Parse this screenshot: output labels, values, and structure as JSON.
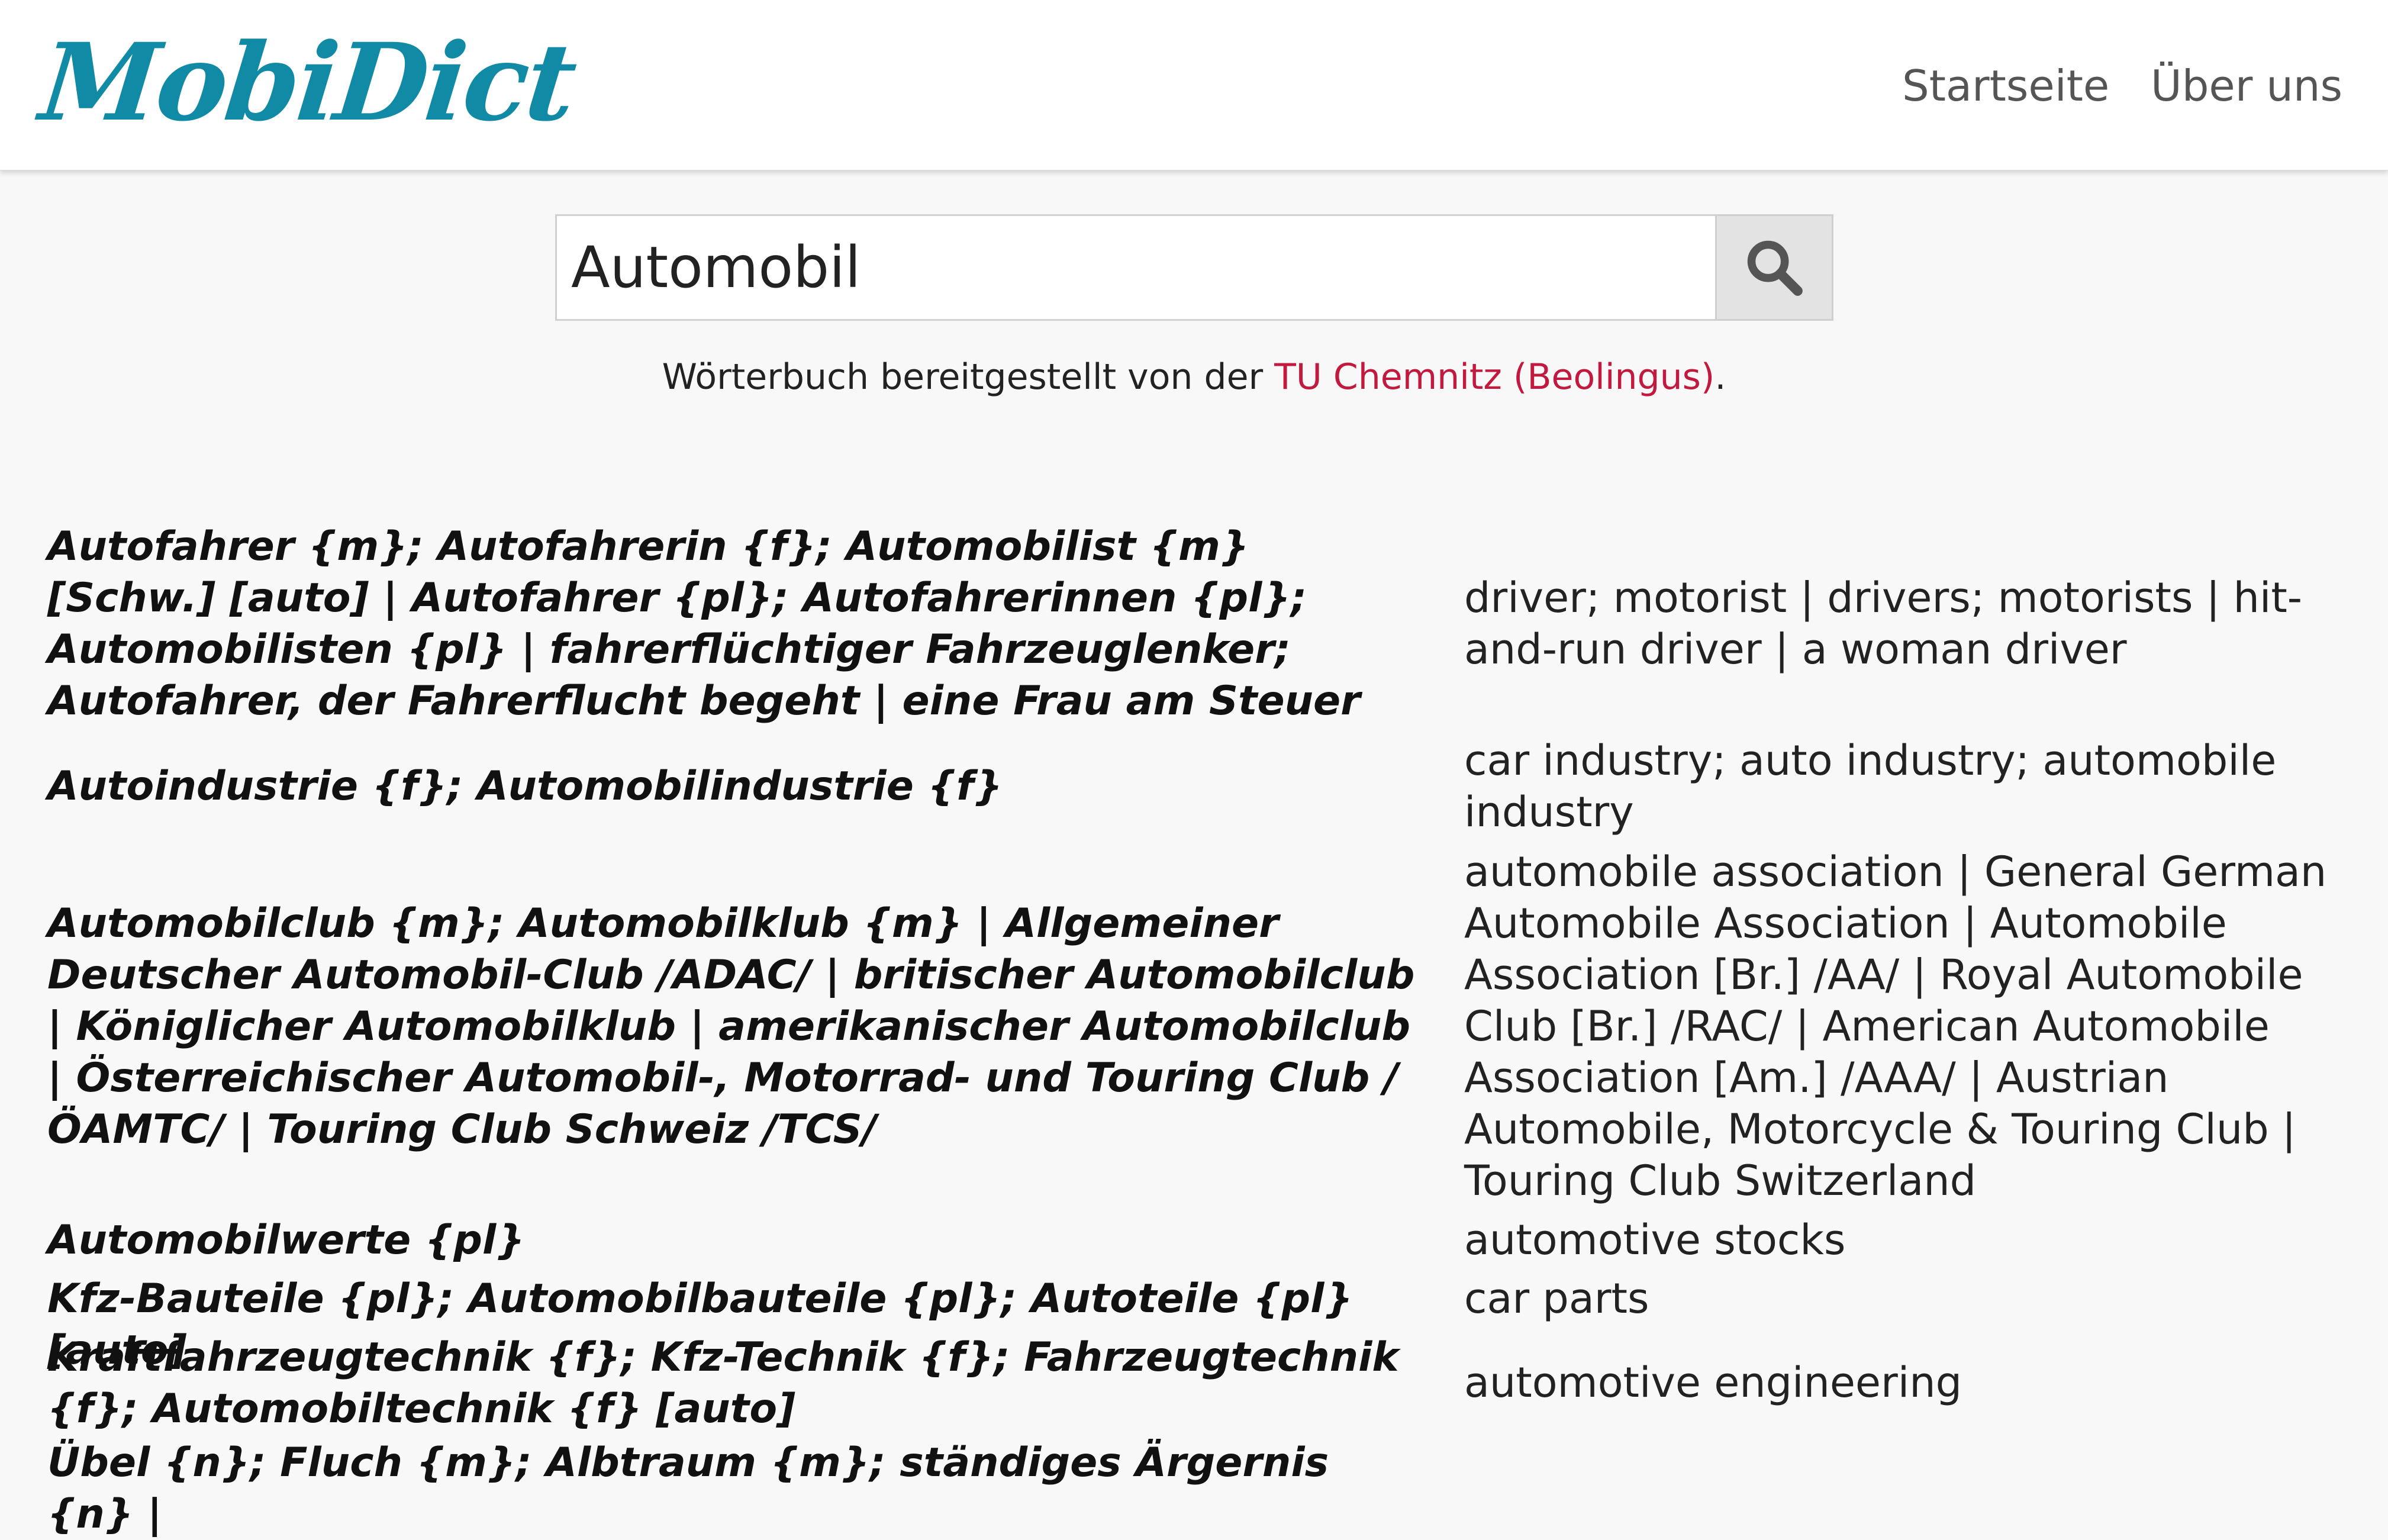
{
  "header": {
    "logo": "MobiDict",
    "nav": {
      "home": "Startseite",
      "about": "Über uns"
    }
  },
  "search": {
    "value": "Automobil",
    "button_icon": "search-icon"
  },
  "credit": {
    "prefix": "Wörterbuch bereitgestellt von der ",
    "link": "TU Chemnitz (Beolingus)",
    "suffix": "."
  },
  "results": [
    {
      "de": "Autofahrer {m}; Autofahrerin {f}; Automobilist {m} [Schw.] [auto] | Autofahrer {pl}; Autofahrerinnen {pl}; Automobilisten {pl} | fahrerflüchtiger Fahrzeuglenker; Autofahrer, der Fahrerflucht begeht | eine Frau am Steuer",
      "en": "driver; motorist | drivers; motorists | hit-and-run driver | a woman driver"
    },
    {
      "de": "Autoindustrie {f}; Automobilindustrie {f}",
      "en": "car industry; auto industry; automobile industry"
    },
    {
      "de": "Automobilclub {m}; Automobilklub {m} | Allgemeiner Deutscher Automobil-Club /ADAC/ | britischer Automobilclub | Königlicher Automobilklub | amerikanischer Automobilclub | Österreichischer Automobil-, Motorrad- und Touring Club /ÖAMTC/ | Touring Club Schweiz /TCS/",
      "en": "automobile association | General German Automobile Association | Automobile Association [Br.] /AA/ | Royal Automobile Club [Br.] /RAC/ | American Automobile Association [Am.] /AAA/ | Austrian Automobile, Motorcycle & Touring Club | Touring Club Switzerland"
    },
    {
      "de": "Automobilwerte {pl}",
      "en": "automotive stocks"
    },
    {
      "de": "Kfz-Bauteile {pl}; Automobilbauteile {pl}; Autoteile {pl} [auto]",
      "en": "car parts"
    },
    {
      "de": "Kraftfahrzeugtechnik {f}; Kfz-Technik {f}; Fahrzeugtechnik {f}; Automobiltechnik {f} [auto]",
      "en": "automotive engineering"
    },
    {
      "de": "Übel {n}; Fluch {m}; Albtraum {m}; ständiges Ärgernis {n} |",
      "en": ""
    }
  ]
}
